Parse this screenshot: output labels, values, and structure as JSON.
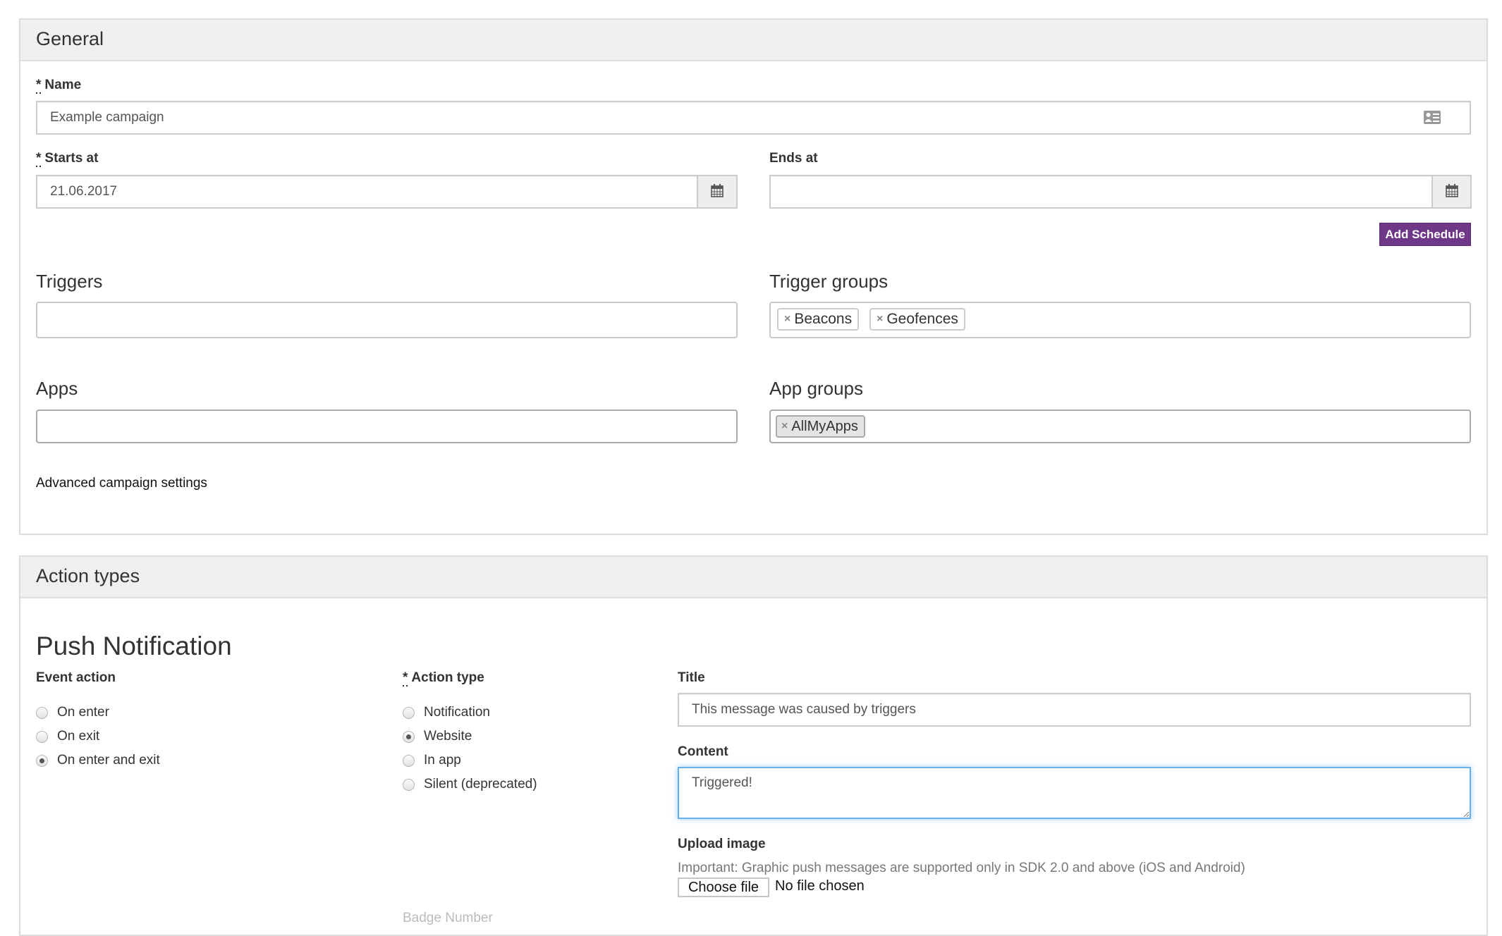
{
  "general": {
    "title": "General",
    "name": {
      "label": "Name",
      "required_mark": "*",
      "value": "Example campaign",
      "icon": "contact-card-icon"
    },
    "starts_at": {
      "label": "Starts at",
      "required_mark": "*",
      "value": "21.06.2017",
      "icon": "calendar-icon"
    },
    "ends_at": {
      "label": "Ends at",
      "value": "",
      "icon": "calendar-icon"
    },
    "add_schedule_label": "Add Schedule",
    "triggers": {
      "label": "Triggers",
      "tags": []
    },
    "trigger_groups": {
      "label": "Trigger groups",
      "tags": [
        {
          "remove": "×",
          "label": "Beacons"
        },
        {
          "remove": "×",
          "label": "Geofences"
        }
      ]
    },
    "apps": {
      "label": "Apps",
      "tags": []
    },
    "app_groups": {
      "label": "App groups",
      "tags": [
        {
          "remove": "×",
          "label": "AllMyApps"
        }
      ]
    },
    "advanced_link": "Advanced campaign settings"
  },
  "action_types": {
    "title": "Action types",
    "push": {
      "heading": "Push Notification",
      "event_action": {
        "label": "Event action",
        "options": [
          {
            "label": "On enter",
            "checked": false
          },
          {
            "label": "On exit",
            "checked": false
          },
          {
            "label": "On enter and exit",
            "checked": true
          }
        ]
      },
      "action_type": {
        "label": "Action type",
        "required_mark": "*",
        "options": [
          {
            "label": "Notification",
            "checked": false
          },
          {
            "label": "Website",
            "checked": true
          },
          {
            "label": "In app",
            "checked": false
          },
          {
            "label": "Silent (deprecated)",
            "checked": false
          }
        ]
      },
      "title_field": {
        "label": "Title",
        "value": "This message was caused by triggers"
      },
      "content_field": {
        "label": "Content",
        "value": "Triggered!"
      },
      "upload": {
        "label": "Upload image",
        "note": "Important: Graphic push messages are supported only in SDK 2.0 and above (iOS and Android)",
        "button": "Choose file",
        "status": "No file chosen"
      },
      "cut_off_label": "Badge Number"
    }
  },
  "colors": {
    "accent": "#6f3787",
    "focus": "#66afe9",
    "panel_header": "#f0eeef"
  }
}
